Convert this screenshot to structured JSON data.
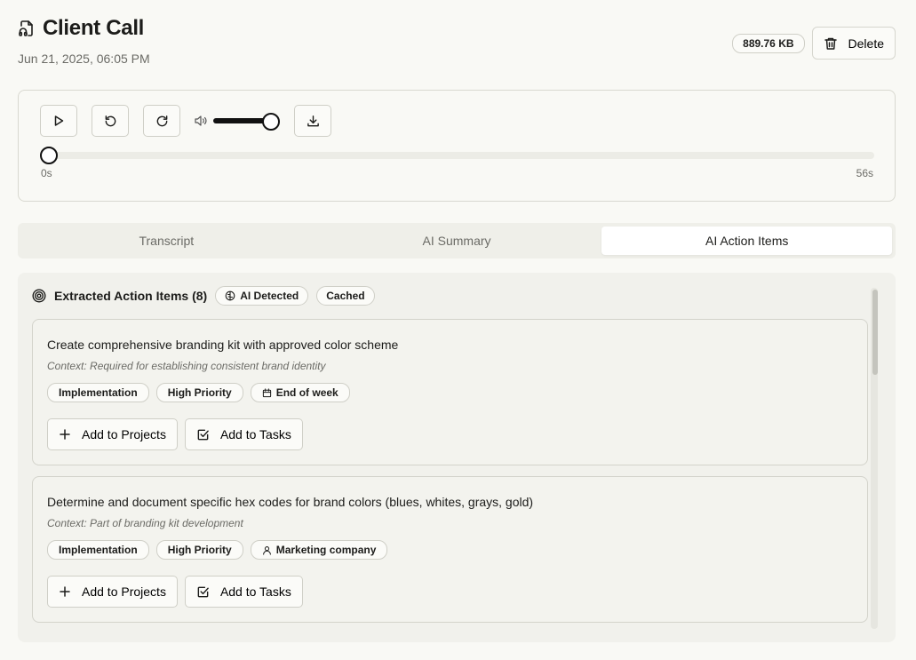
{
  "header": {
    "title": "Client Call",
    "date": "Jun 21, 2025, 06:05 PM",
    "file_size": "889.76 KB",
    "delete_label": "Delete"
  },
  "player": {
    "current_time": "0s",
    "duration": "56s",
    "progress": 0,
    "volume": 1.0
  },
  "tabs": [
    {
      "label": "Transcript",
      "active": false
    },
    {
      "label": "AI Summary",
      "active": false
    },
    {
      "label": "AI Action Items",
      "active": true
    }
  ],
  "panel": {
    "title": "Extracted Action Items (8)",
    "ai_badge": "AI Detected",
    "cached_badge": "Cached"
  },
  "items": [
    {
      "title": "Create comprehensive branding kit with approved color scheme",
      "context": "Context: Required for establishing consistent brand identity",
      "type": "Implementation",
      "priority": "High Priority",
      "meta": "End of week",
      "meta_icon": "calendar-icon",
      "add_projects": "Add to Projects",
      "add_tasks": "Add to Tasks"
    },
    {
      "title": "Determine and document specific hex codes for brand colors (blues, whites, grays, gold)",
      "context": "Context: Part of branding kit development",
      "type": "Implementation",
      "priority": "High Priority",
      "meta": "Marketing company",
      "meta_icon": "user-icon",
      "add_projects": "Add to Projects",
      "add_tasks": "Add to Tasks"
    }
  ]
}
